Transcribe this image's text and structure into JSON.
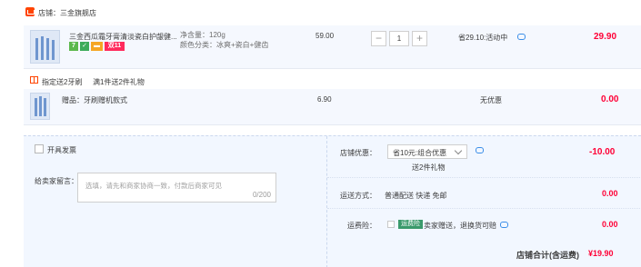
{
  "store": {
    "label": "店铺：三金旗舰店"
  },
  "item": {
    "title": "三金西瓜霜牙膏清淡瓷白护龈健...",
    "sku": {
      "weight": "净含量：120g",
      "color": "颜色分类：冰爽+瓷白+健齿"
    },
    "badges": {
      "seven": "7",
      "double11": "双11"
    },
    "unit_price": "59.00",
    "quantity": "1",
    "minus": "−",
    "plus": "+",
    "discount": "省29.10:活动中",
    "total": "29.90"
  },
  "gift": {
    "tag": "指定送2牙刷",
    "promo": "满1件送2件礼物",
    "name": "赠品：牙刷赠机款式",
    "price": "6.90",
    "discount": "无优惠",
    "total": "0.00"
  },
  "order": {
    "invoice_label": "开具发票",
    "message_label": "给卖家留言：",
    "message_placeholder": "选填，请先和商家协商一致，付款后商家可见",
    "message_count": "0/200",
    "shop_discount_label": "店铺优惠：",
    "shop_discount_value": "省10元:组合优惠",
    "shop_discount_sub": "送2件礼物",
    "shop_discount_amount": "-10.00",
    "delivery_label": "运送方式：",
    "delivery_value": "普通配送 快递 免邮",
    "delivery_amount": "0.00",
    "insurance_label": "运费险：",
    "insurance_badge": "运费险",
    "insurance_text": "卖家赠送，退换货可赔",
    "insurance_amount": "0.00",
    "subtotal_label": "店铺合计(含运费)",
    "subtotal_value": "¥19.90"
  },
  "colors": {
    "accent": "#ff0036",
    "brand": "#ff4400",
    "row_bg": "#f5f8fe",
    "section_bg": "#f2f7ff"
  }
}
